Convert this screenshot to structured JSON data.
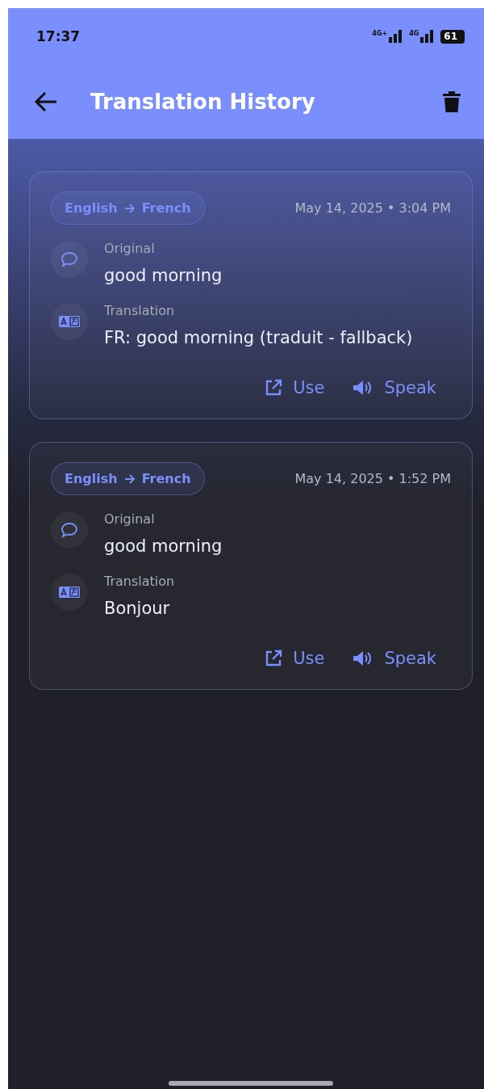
{
  "status_bar": {
    "time": "17:37",
    "network_1": "4G+",
    "network_2": "4G",
    "battery": "61"
  },
  "app_bar": {
    "title": "Translation History"
  },
  "entries": [
    {
      "from": "English",
      "to": "French",
      "timestamp": "May 14, 2025 • 3:04 PM",
      "original_label": "Original",
      "original": "good morning",
      "translation_label": "Translation",
      "translation": "FR: good morning (traduit - fallback)",
      "actions": [
        "Use",
        "Speak"
      ]
    },
    {
      "from": "English",
      "to": "French",
      "timestamp": "May 14, 2025 • 1:52 PM",
      "original_label": "Original",
      "original": "good morning",
      "translation_label": "Translation",
      "translation": "Bonjour",
      "actions": [
        "Use",
        "Speak"
      ]
    }
  ]
}
